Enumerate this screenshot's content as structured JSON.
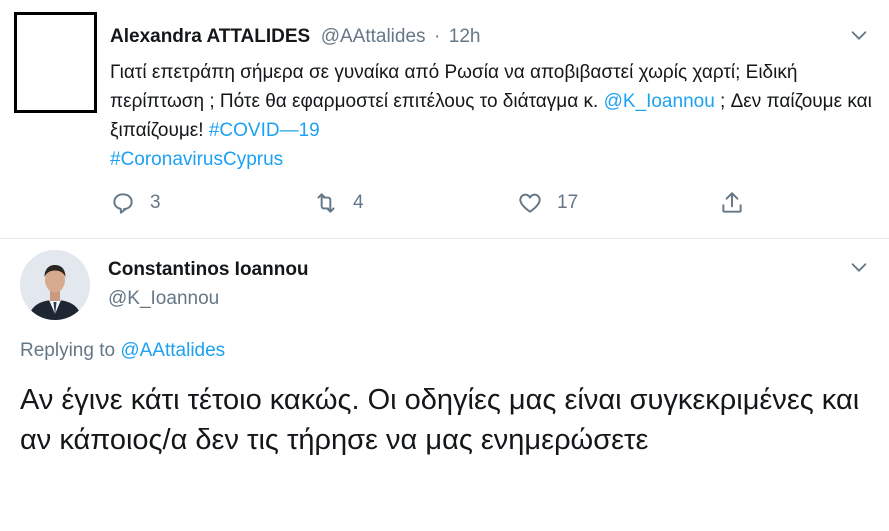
{
  "tweet1": {
    "author_name": "Alexandra ATTALIDES",
    "handle": "@AAttalides",
    "separator": "·",
    "time": "12h",
    "text_1": "Γιατί επετράπη σήμερα σε γυναίκα από Ρωσία να αποβιβαστεί χωρίς χαρτί; Ειδική  περίπτωση ; Πότε θα εφαρμοστεί επιτέλους το διάταγμα κ. ",
    "mention": "@K_Ioannou",
    "text_2": " ; Δεν παίζουμε και ξιπαίζουμε! ",
    "hashtag_1": "#COVID—19",
    "hashtag_2": "#CoronavirusCyprus",
    "replies": "3",
    "retweets": "4",
    "likes": "17"
  },
  "tweet2": {
    "author_name": "Constantinos Ioannou",
    "handle": "@K_Ioannou",
    "replying_prefix": "Replying to ",
    "replying_to": "@AAttalides",
    "text": "Αν έγινε κάτι τέτοιο κακώς. Οι οδηγίες μας είναι συγκεκριμένες και αν κάποιος/α δεν τις τήρησε να μας ενημερώσετε"
  },
  "icons": [
    "chevron-down-icon",
    "reply-icon",
    "retweet-icon",
    "like-icon",
    "share-icon"
  ],
  "colors": {
    "link": "#1da1f2",
    "muted": "#657786",
    "text": "#14171a",
    "divider": "#e6ecf0"
  }
}
